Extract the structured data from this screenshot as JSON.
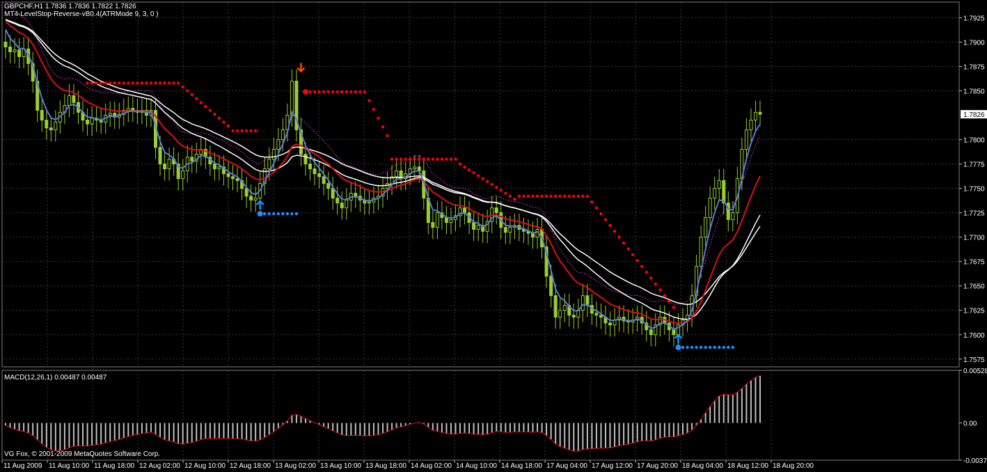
{
  "main_chart": {
    "header_line1": "GBPCHF,H1  1.7836 1.7836 1.7822 1.7826",
    "header_line2": "MT4-LevelStop-Reverse-vB0.4(ATRMode 9, 3, 0 )",
    "current_price": "1.7826",
    "price_ticks": [
      "1.7925",
      "1.7900",
      "1.7875",
      "1.7850",
      "1.7800",
      "1.7775",
      "1.7750",
      "1.7725",
      "1.7700",
      "1.7675",
      "1.7650",
      "1.7625",
      "1.7600",
      "1.7575"
    ],
    "price_tick_values": [
      1.7925,
      1.79,
      1.7875,
      1.785,
      1.78,
      1.7775,
      1.775,
      1.7725,
      1.77,
      1.7675,
      1.765,
      1.7625,
      1.76,
      1.7575
    ],
    "price_range": [
      1.7567,
      1.7941
    ]
  },
  "macd": {
    "label": "MACD(12,26,1) 0.00487 0.00487",
    "ticks": [
      "0.00528",
      "0.00",
      "-0.00373"
    ],
    "tick_values": [
      0.00528,
      0.0,
      -0.00373
    ],
    "range": [
      -0.00373,
      0.00528
    ]
  },
  "time_axis": {
    "labels": [
      "11 Aug 2009",
      "11 Aug 10:00",
      "11 Aug 18:00",
      "12 Aug 02:00",
      "12 Aug 10:00",
      "12 Aug 18:00",
      "13 Aug 02:00",
      "13 Aug 10:00",
      "13 Aug 18:00",
      "14 Aug 02:00",
      "14 Aug 10:00",
      "14 Aug 18:00",
      "17 Aug 04:00",
      "17 Aug 12:00",
      "17 Aug 20:00",
      "18 Aug 04:00",
      "18 Aug 12:00",
      "18 Aug 20:00"
    ]
  },
  "copyright": "VG Fox, © 2001-2009 MetaQuotes Software Corp.",
  "colors": {
    "background": "#000000",
    "grid": "#3a3a3a",
    "candle": "#9acd32",
    "fast_ma": "#5b7bd5",
    "mid_ma": "#e01010",
    "slow_ma": "#ffffff",
    "stop_line": "#ff0000",
    "buy_stop_line": "#1e90ff",
    "envelope": "#c030c0",
    "macd_hist": "#c0c0c0",
    "macd_signal": "#e01010"
  },
  "chart_data": {
    "type": "line",
    "closes": [
      1.7895,
      1.789,
      1.7892,
      1.7885,
      1.7893,
      1.7878,
      1.786,
      1.783,
      1.782,
      1.7812,
      1.781,
      1.7818,
      1.7828,
      1.7835,
      1.7845,
      1.7838,
      1.7828,
      1.782,
      1.7816,
      1.7822,
      1.782,
      1.7818,
      1.7825,
      1.7827,
      1.7823,
      1.7826,
      1.783,
      1.7832,
      1.783,
      1.7828,
      1.783,
      1.7825,
      1.783,
      1.7792,
      1.7775,
      1.777,
      1.778,
      1.7775,
      1.776,
      1.7768,
      1.7782,
      1.7778,
      1.7785,
      1.779,
      1.7782,
      1.7775,
      1.777,
      1.7772,
      1.7765,
      1.7762,
      1.776,
      1.7758,
      1.775,
      1.7742,
      1.7738,
      1.774,
      1.7755,
      1.777,
      1.778,
      1.779,
      1.78,
      1.781,
      1.7825,
      1.786,
      1.781,
      1.7785,
      1.7775,
      1.777,
      1.7765,
      1.7762,
      1.7755,
      1.775,
      1.774,
      1.7735,
      1.773,
      1.7738,
      1.7745,
      1.7742,
      1.7738,
      1.7735,
      1.7736,
      1.774,
      1.7742,
      1.775,
      1.7755,
      1.7762,
      1.7768,
      1.776,
      1.7765,
      1.777,
      1.7772,
      1.7768,
      1.774,
      1.7715,
      1.771,
      1.7725,
      1.772,
      1.7715,
      1.7718,
      1.7722,
      1.773,
      1.7725,
      1.7715,
      1.7708,
      1.7712,
      1.7706,
      1.7716,
      1.773,
      1.7725,
      1.771,
      1.7705,
      1.771,
      1.7712,
      1.7708,
      1.7706,
      1.7704,
      1.77,
      1.7708,
      1.769,
      1.766,
      1.764,
      1.7618,
      1.7625,
      1.763,
      1.762,
      1.7618,
      1.7625,
      1.764,
      1.763,
      1.7622,
      1.762,
      1.7618,
      1.7612,
      1.761,
      1.7615,
      1.7618,
      1.7614,
      1.7613,
      1.7615,
      1.7618,
      1.7612,
      1.7605,
      1.76,
      1.761,
      1.7618,
      1.7612,
      1.7605,
      1.76,
      1.761,
      1.7615,
      1.762,
      1.764,
      1.767,
      1.77,
      1.772,
      1.774,
      1.775,
      1.7758,
      1.7735,
      1.7718,
      1.7725,
      1.776,
      1.779,
      1.781,
      1.782,
      1.7828,
      1.7826
    ]
  }
}
